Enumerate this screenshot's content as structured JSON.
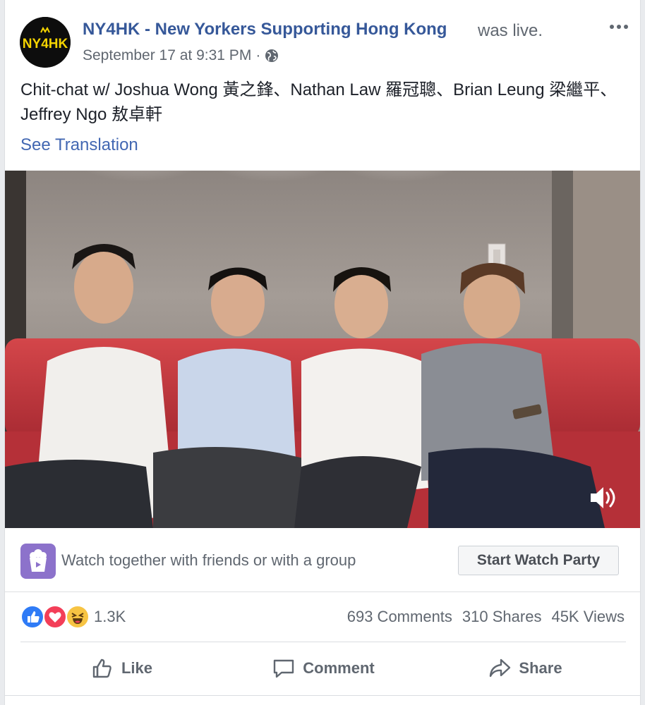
{
  "post": {
    "page_name": "NY4HK - New Yorkers Supporting Hong Kong",
    "live_suffix": "was live.",
    "avatar_text": "NY4HK",
    "timestamp": "September 17 at 9:31 PM",
    "separator": "·",
    "privacy_icon": "globe-icon",
    "message": "Chit-chat w/ Joshua Wong 黃之鋒、Nathan Law 羅冠聰、Brian Leung 梁繼平、Jeffrey Ngo 敖卓軒",
    "see_translation": "See Translation"
  },
  "video": {
    "volume_icon": "volume-icon"
  },
  "watch_party": {
    "text": "Watch together with friends or with a group",
    "button_label": "Start Watch Party",
    "icon": "popcorn-icon",
    "accent": "#8c72cb"
  },
  "reactions": {
    "count": "1.3K",
    "types": [
      "like",
      "love",
      "haha"
    ],
    "comments": "693 Comments",
    "shares": "310 Shares",
    "views": "45K Views"
  },
  "actions": {
    "like": "Like",
    "comment": "Comment",
    "share": "Share"
  },
  "colors": {
    "link": "#365899",
    "translation": "#4267b2",
    "secondary_text": "#606770",
    "like_blue": "#2f7bf6",
    "love_red": "#f33e58",
    "haha_yellow": "#f7c443"
  }
}
